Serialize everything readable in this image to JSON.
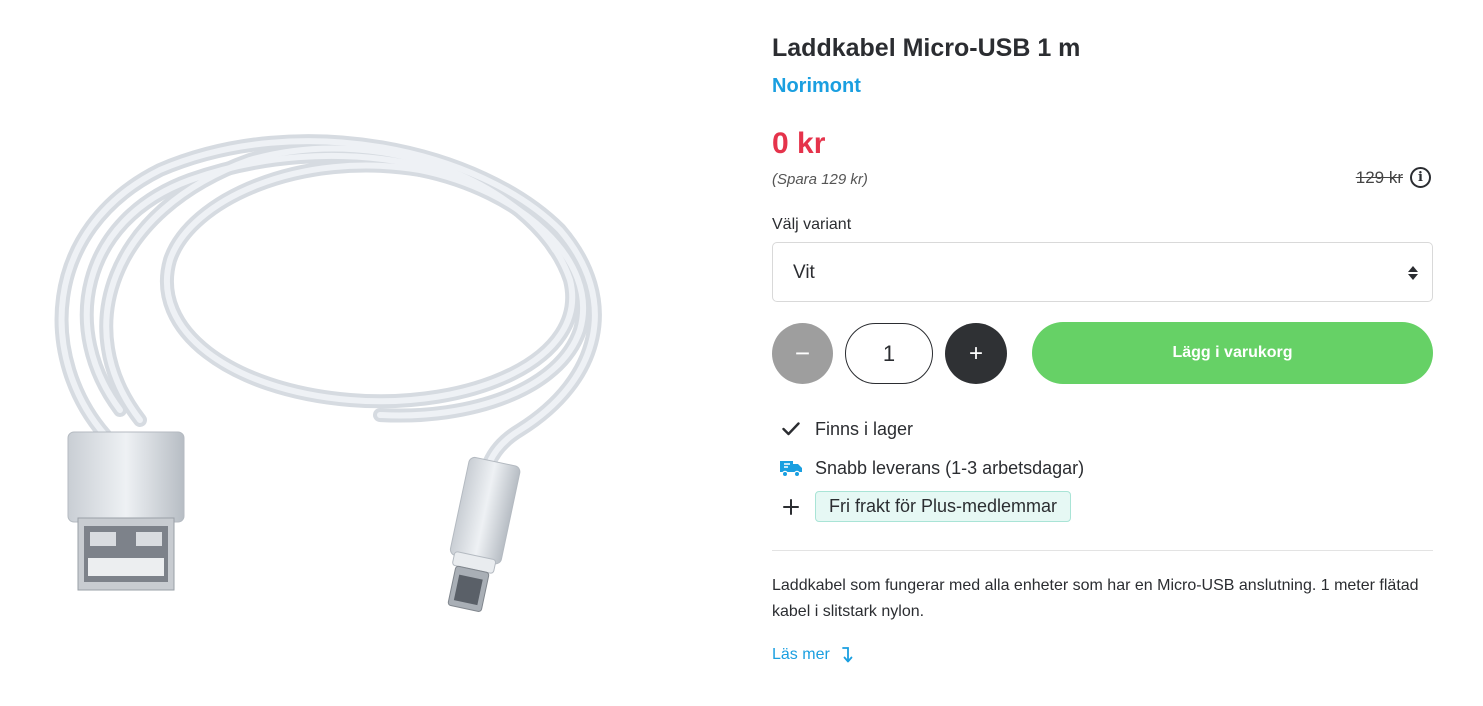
{
  "product": {
    "title": "Laddkabel Micro-USB 1 m",
    "brand": "Norimont",
    "price": "0 kr",
    "savings": "(Spara 129 kr)",
    "original_price": "129 kr",
    "image_alt": "Vit flätad Micro-USB laddkabel"
  },
  "variant": {
    "label": "Välj variant",
    "selected": "Vit"
  },
  "purchase": {
    "minus_label": "−",
    "quantity": "1",
    "plus_label": "+",
    "add_to_cart_label": "Lägg i varukorg"
  },
  "usps": [
    {
      "icon": "check-icon",
      "text": "Finns i lager"
    },
    {
      "icon": "truck-icon",
      "text": "Snabb leverans (1-3 arbetsdagar)"
    },
    {
      "icon": "plus-icon",
      "text": "Fri frakt för Plus-medlemmar"
    }
  ],
  "description": "Laddkabel som fungerar med alla enheter som har en Micro-USB anslutning. 1 meter flätad kabel i slitstark nylon.",
  "read_more_label": "Läs mer",
  "colors": {
    "brand_link": "#1a9fe0",
    "price": "#e5334b",
    "add_to_cart": "#66d166",
    "plus_badge_bg": "#e6f8f4",
    "truck_icon": "#1a9fe0"
  }
}
